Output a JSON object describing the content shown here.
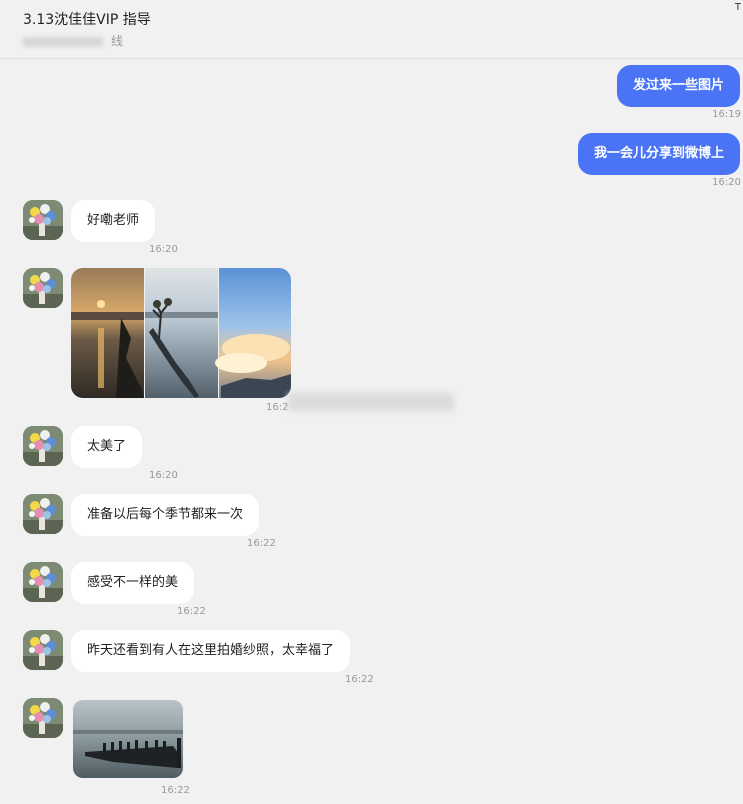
{
  "header": {
    "title": "3.13沈佳佳VIP 指导",
    "status": "线",
    "corner": "T"
  },
  "messages": [
    {
      "side": "out",
      "text": "发过来一些图片",
      "time": "16:19"
    },
    {
      "side": "out",
      "text": "我一会儿分享到微博上",
      "time": "16:20"
    },
    {
      "side": "in",
      "text": "好嘞老师",
      "time": "16:20"
    },
    {
      "side": "in",
      "type": "images",
      "time": "16:2"
    },
    {
      "side": "in",
      "text": "太美了",
      "time": "16:20"
    },
    {
      "side": "in",
      "text": "准备以后每个季节都来一次",
      "time": "16:22"
    },
    {
      "side": "in",
      "text": "感受不一样的美",
      "time": "16:22"
    },
    {
      "side": "in",
      "text": "昨天还看到有人在这里拍婚纱照，太幸福了",
      "time": "16:22"
    },
    {
      "side": "in",
      "type": "image",
      "time": "16:22"
    }
  ],
  "colors": {
    "outgoing_bubble": "#4a74f5",
    "incoming_bubble": "#ffffff",
    "background": "#f1f1f1"
  }
}
